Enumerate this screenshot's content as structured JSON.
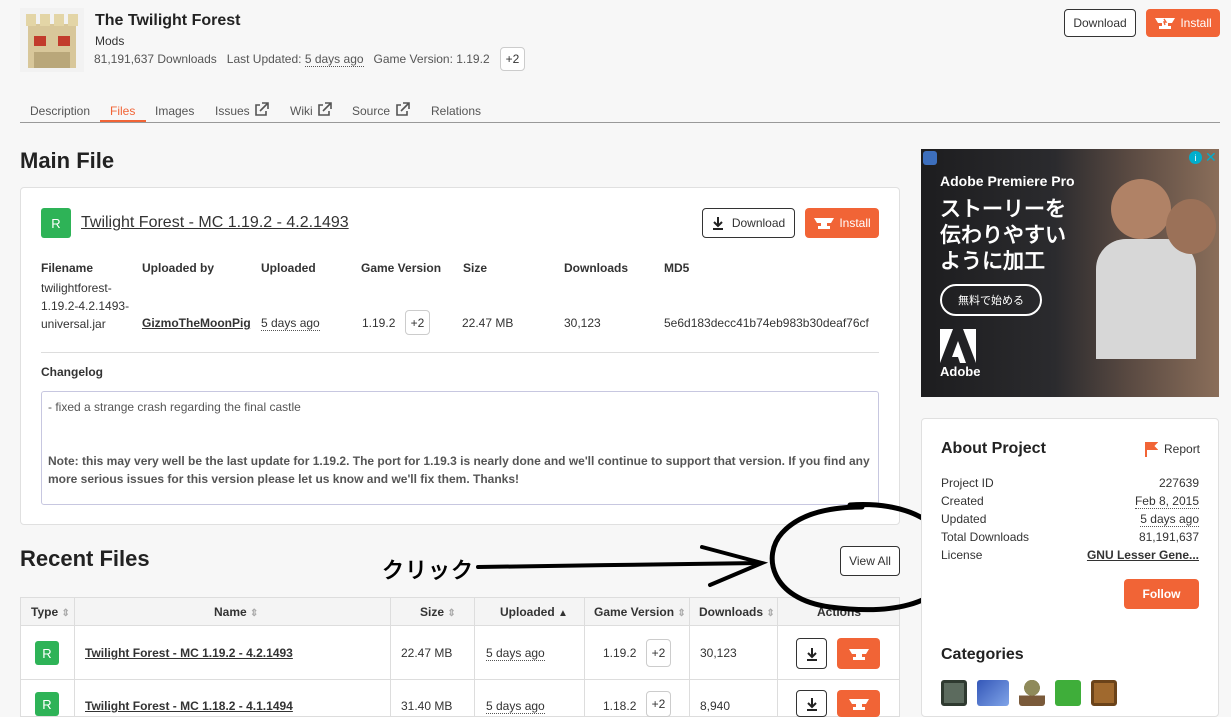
{
  "project": {
    "title": "The Twilight Forest",
    "category": "Mods",
    "downloads": "81,191,637 Downloads",
    "last_updated_label": "Last Updated:",
    "last_updated": "5 days ago",
    "game_version_label": "Game Version: 1.19.2",
    "extra_versions": "+2",
    "download_label": "Download",
    "install_label": "Install"
  },
  "tabs": [
    "Description",
    "Files",
    "Images",
    "Issues",
    "Wiki",
    "Source",
    "Relations"
  ],
  "main_file": {
    "heading": "Main File",
    "badge": "R",
    "name": "Twilight Forest - MC 1.19.2 - 4.2.1493",
    "download_label": "Download",
    "install_label": "Install",
    "headers": [
      "Filename",
      "Uploaded by",
      "Uploaded",
      "Game Version",
      "Size",
      "Downloads",
      "MD5"
    ],
    "filename_lines": [
      "twilightforest-",
      "1.19.2-4.2.1493-",
      "universal.jar"
    ],
    "uploader": "GizmoTheMoonPig",
    "uploaded": "5 days ago",
    "game_version": "1.19.2",
    "extra_versions": "+2",
    "size": "22.47 MB",
    "downloads": "30,123",
    "md5": "5e6d183decc41b74eb983b30deaf76cf",
    "changelog_label": "Changelog",
    "changelog_line1": "- fixed a strange crash regarding the final castle",
    "changelog_note": "Note: this may very well be the last update for 1.19.2. The port for 1.19.3 is nearly done and we'll continue to support that version. If you find any more serious issues for this version please let us know and we'll fix them. Thanks!"
  },
  "recent_files": {
    "heading": "Recent Files",
    "view_all": "View All",
    "annotation": "クリック",
    "columns": [
      "Type",
      "Name",
      "Size",
      "Uploaded",
      "Game Version",
      "Downloads",
      "Actions"
    ],
    "rows": [
      {
        "type": "R",
        "name": "Twilight Forest - MC 1.19.2 - 4.2.1493",
        "size": "22.47 MB",
        "uploaded": "5 days ago",
        "version": "1.19.2",
        "extra": "+2",
        "downloads": "30,123"
      },
      {
        "type": "R",
        "name": "Twilight Forest - MC 1.18.2 - 4.1.1494",
        "size": "31.40 MB",
        "uploaded": "5 days ago",
        "version": "1.18.2",
        "extra": "+2",
        "downloads": "8,940"
      }
    ]
  },
  "ad": {
    "brand_line": "Adobe Premiere Pro",
    "headline": [
      "ストーリーを",
      "伝わりやすい",
      "ように加工"
    ],
    "cta": "無料で始める",
    "logo_text": "Adobe"
  },
  "about": {
    "heading": "About Project",
    "report_label": "Report",
    "rows": [
      {
        "label": "Project ID",
        "value": "227639"
      },
      {
        "label": "Created",
        "value": "Feb 8, 2015"
      },
      {
        "label": "Updated",
        "value": "5 days ago"
      },
      {
        "label": "Total Downloads",
        "value": "81,191,637"
      },
      {
        "label": "License",
        "value": "GNU Lesser Gene..."
      }
    ],
    "follow_label": "Follow"
  },
  "categories": {
    "heading": "Categories"
  },
  "colors": {
    "accent": "#f16436",
    "release_green": "#2eb357"
  },
  "icons": [
    "download-icon",
    "install-anvil-icon",
    "external-link-icon",
    "sort-icon",
    "flag-icon"
  ]
}
